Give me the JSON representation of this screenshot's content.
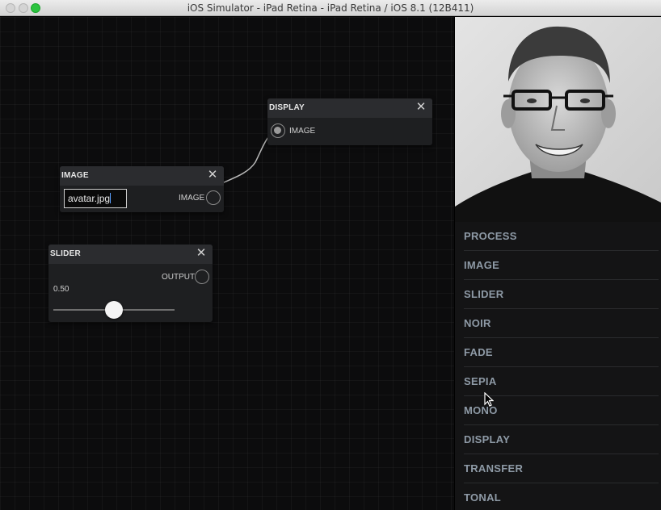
{
  "window": {
    "title": "iOS Simulator - iPad Retina - iPad Retina / iOS 8.1 (12B411)"
  },
  "nodes": {
    "display": {
      "title": "DISPLAY",
      "input_label": "IMAGE",
      "close": "✕"
    },
    "image": {
      "title": "IMAGE",
      "filename": "avatar.jpg",
      "output_label": "IMAGE",
      "close": "✕"
    },
    "slider": {
      "title": "SLIDER",
      "output_label": "OUTPUT",
      "value_text": "0.50",
      "value": 0.5,
      "close": "✕"
    }
  },
  "preview": {
    "subject": "grayscale portrait photo of smiling man with glasses"
  },
  "menu": {
    "items": [
      "PROCESS",
      "IMAGE",
      "SLIDER",
      "NOIR",
      "FADE",
      "SEPIA",
      "MONO",
      "DISPLAY",
      "TRANSFER",
      "TONAL"
    ]
  },
  "colors": {
    "accent_green": "#2bc33f",
    "menu_text": "#8e9aa6",
    "canvas_bg": "#0c0c0d"
  }
}
